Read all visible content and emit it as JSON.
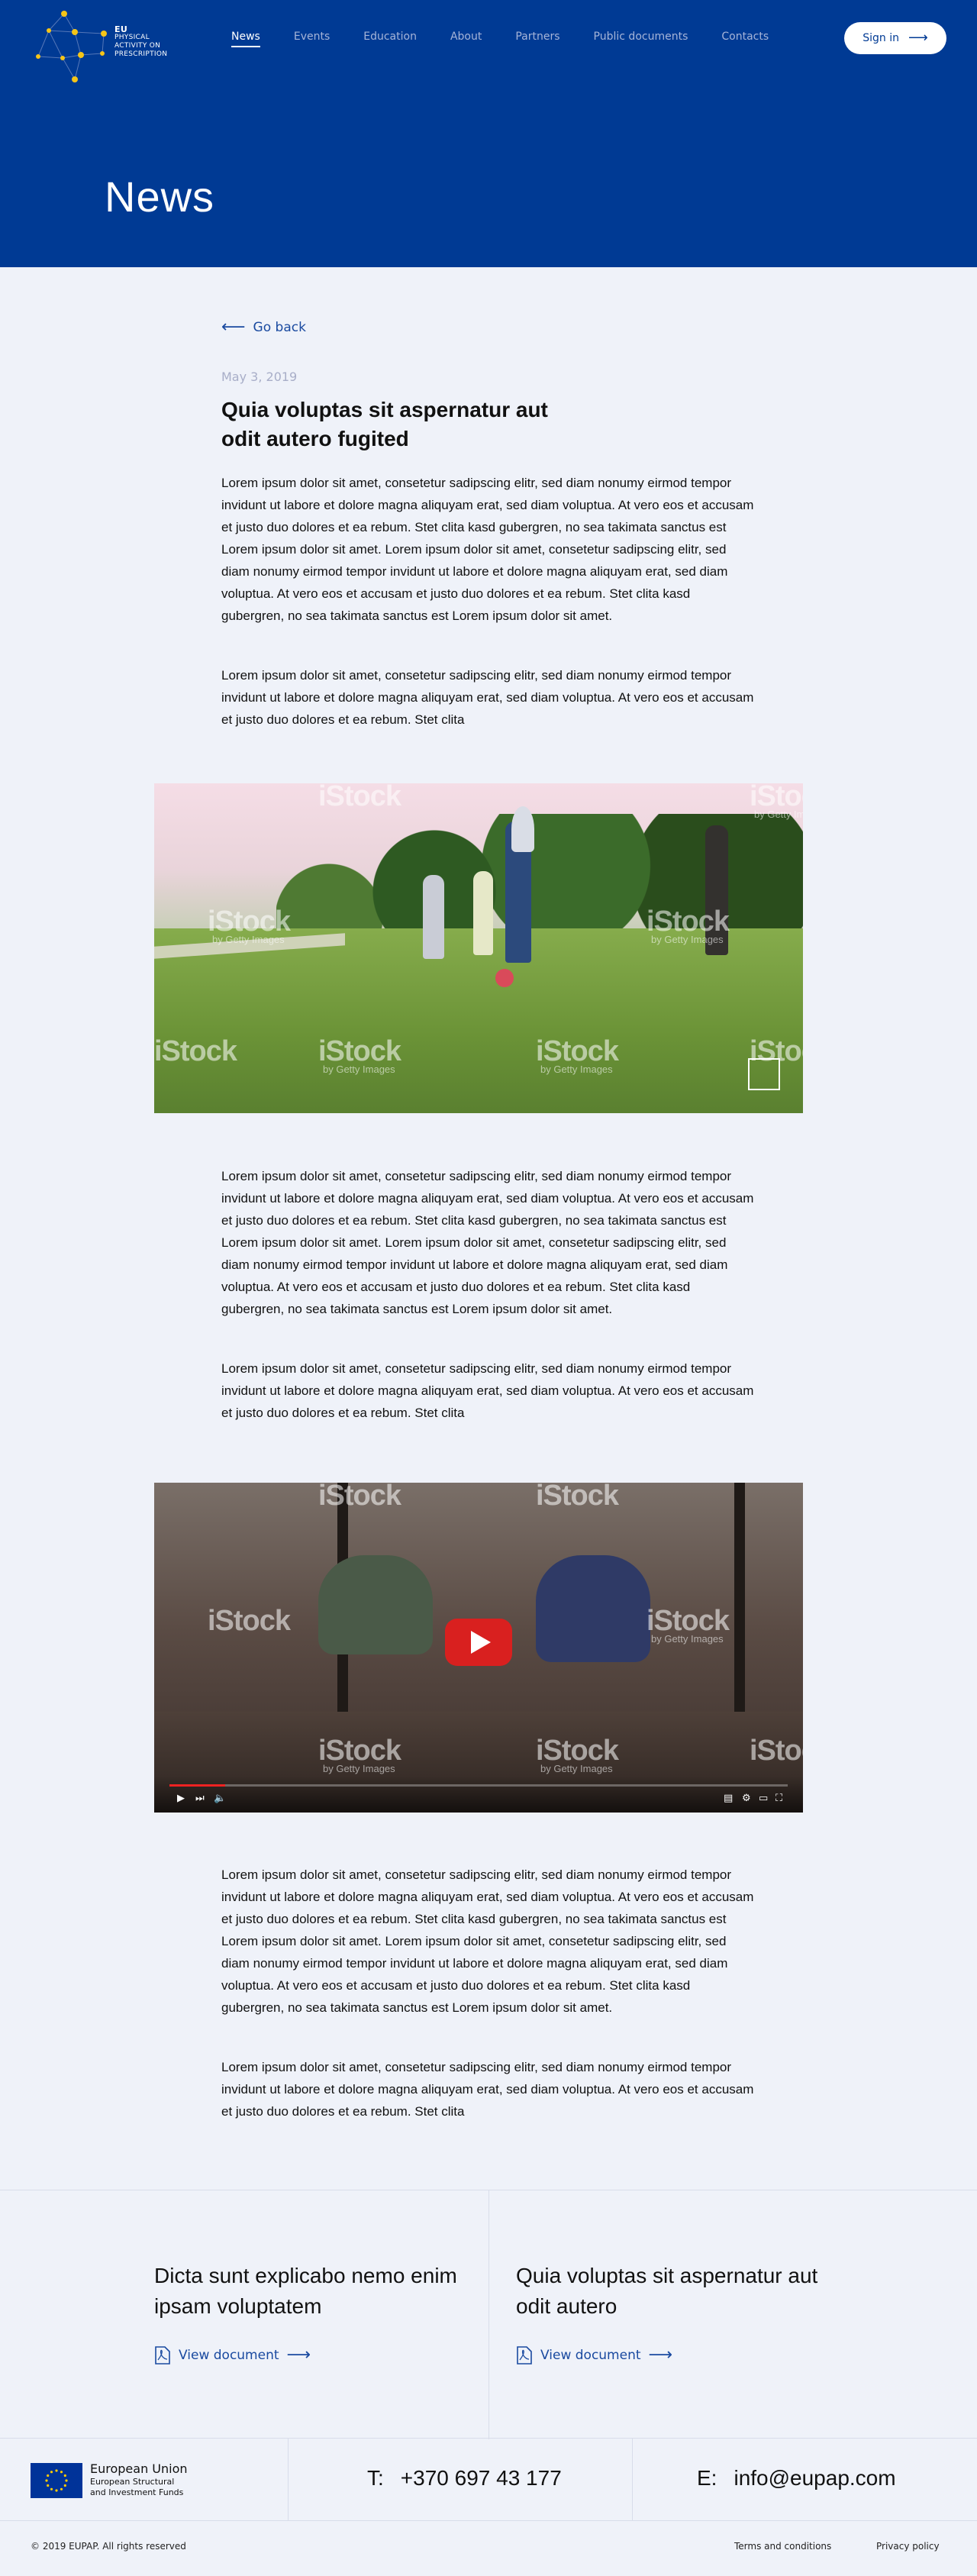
{
  "header": {
    "logo_lines": [
      "EU",
      "PHYSICAL",
      "ACTIVITY ON",
      "PRESCRIPTION"
    ],
    "nav": [
      {
        "label": "News",
        "active": true
      },
      {
        "label": "Events"
      },
      {
        "label": "Education"
      },
      {
        "label": "About"
      },
      {
        "label": "Partners"
      },
      {
        "label": "Public documents"
      },
      {
        "label": "Contacts"
      }
    ],
    "signin_label": "Sign in",
    "page_title": "News"
  },
  "article": {
    "back_label": "Go back",
    "date": "May 3, 2019",
    "title": "Quia voluptas sit aspernatur aut odit autero fugited",
    "paragraph_long": "Lorem ipsum dolor sit amet, consetetur sadipscing elitr, sed diam nonumy eirmod tempor invidunt ut labore et dolore magna aliquyam erat, sed diam voluptua. At vero eos et accusam et justo duo dolores et ea rebum. Stet clita kasd gubergren, no sea takimata sanctus est Lorem ipsum dolor sit amet. Lorem ipsum dolor sit amet, consetetur sadipscing elitr, sed diam nonumy eirmod tempor invidunt ut labore et dolore magna aliquyam erat, sed diam voluptua. At vero eos et accusam et justo duo dolores et ea rebum. Stet clita kasd gubergren, no sea takimata sanctus est Lorem ipsum dolor sit amet.",
    "paragraph_short": "Lorem ipsum dolor sit amet, consetetur sadipscing elitr, sed diam nonumy eirmod tempor invidunt ut labore et dolore magna aliquyam erat, sed diam voluptua. At vero eos et accusam et justo duo dolores et ea rebum. Stet clita",
    "watermark": "iStock",
    "watermark_sub": "by Getty Images",
    "video_progress": 0.09
  },
  "documents": [
    {
      "title": "Dicta sunt explicabo nemo enim ipsam voluptatem",
      "link": "View document"
    },
    {
      "title": "Quia voluptas sit aspernatur aut odit autero",
      "link": "View document"
    }
  ],
  "footer": {
    "eu_title": "European Union",
    "eu_sub1": "European Structural",
    "eu_sub2": "and Investment Funds",
    "phone_label": "T:",
    "phone": "+370 697 43 177",
    "email_label": "E:",
    "email": "info@eupap.com",
    "copyright": "© 2019 EUPAP. All rights reserved",
    "terms": "Terms and conditions",
    "privacy": "Privacy policy"
  },
  "colors": {
    "brand_blue": "#003a94",
    "link_blue": "#1a4aa0",
    "page_bg": "#eff2f9",
    "video_red": "#d9201f"
  }
}
